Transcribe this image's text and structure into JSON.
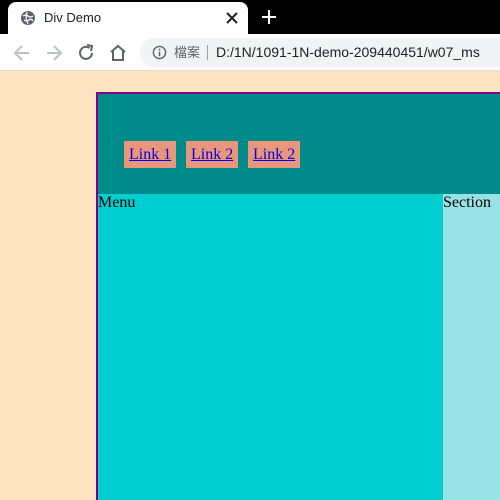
{
  "browser": {
    "tab": {
      "title": "Div Demo",
      "favicon": "globe-icon",
      "close_icon": "close-icon"
    },
    "new_tab_icon": "plus-icon",
    "toolbar": {
      "back_icon": "arrow-left-icon",
      "forward_icon": "arrow-right-icon",
      "reload_icon": "reload-icon",
      "home_icon": "home-icon",
      "security_icon": "info-icon",
      "security_label": "檔案",
      "url": "D:/1N/1091-1N-demo-209440451/w07_ms"
    }
  },
  "page": {
    "header": {
      "links": [
        {
          "label": "Link 1"
        },
        {
          "label": "Link 2"
        },
        {
          "label": "Link 2"
        }
      ]
    },
    "menu": {
      "label": "Menu"
    },
    "section": {
      "label": "Section"
    }
  },
  "colors": {
    "page_background": "#ffe4c4",
    "container_border": "#800080",
    "header_background": "#008b8b",
    "link_background": "#e9967a",
    "menu_background": "#00ced1",
    "section_background": "#98e2e6"
  }
}
